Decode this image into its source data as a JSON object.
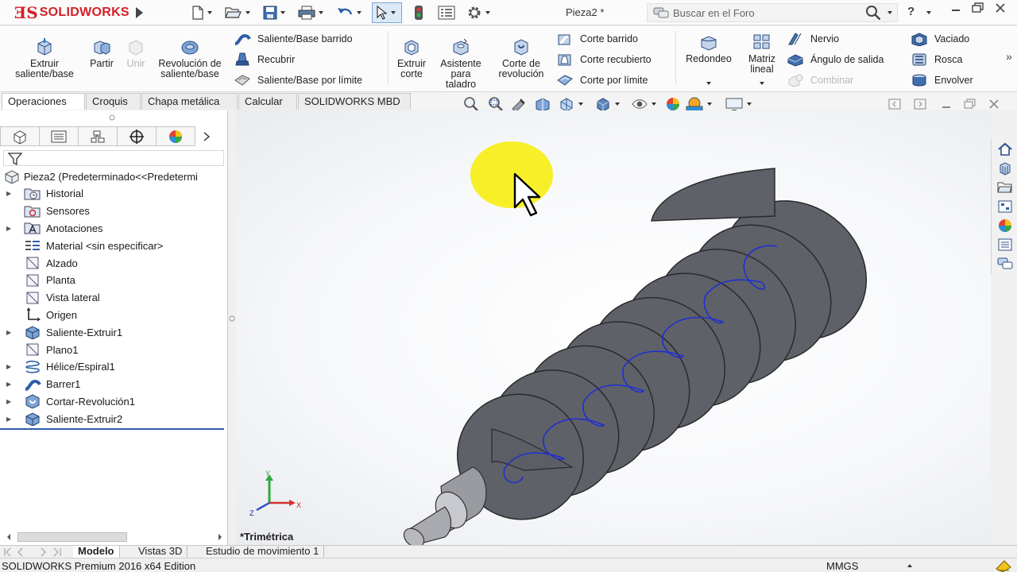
{
  "app": {
    "logo_text": "SOLIDWORKS",
    "document_title": "Pieza2 *",
    "search_placeholder": "Buscar en el Foro",
    "help_glyph": "?"
  },
  "command_manager": {
    "features_big": [
      {
        "label": "Extruir saliente/base",
        "icon": "extrude-boss-icon",
        "enabled": true
      },
      {
        "label": "Partir",
        "icon": "split-icon",
        "enabled": true
      },
      {
        "label": "Unir",
        "icon": "combine-join-icon",
        "enabled": false
      },
      {
        "label": "Revolución de saliente/base",
        "icon": "revolve-boss-icon",
        "enabled": true
      }
    ],
    "features_small": [
      {
        "label": "Saliente/Base barrido",
        "icon": "swept-boss-icon",
        "enabled": true
      },
      {
        "label": "Recubrir",
        "icon": "loft-icon",
        "enabled": true
      },
      {
        "label": "Saliente/Base por límite",
        "icon": "boundary-boss-icon",
        "enabled": true
      }
    ],
    "cut_big": [
      {
        "label": "Extruir corte",
        "icon": "extruded-cut-icon",
        "enabled": true
      },
      {
        "label": "Asistente para taladro",
        "icon": "hole-wizard-icon",
        "enabled": true
      },
      {
        "label": "Corte de revolución",
        "icon": "revolved-cut-icon",
        "enabled": true
      }
    ],
    "cut_small": [
      {
        "label": "Corte barrido",
        "icon": "swept-cut-icon",
        "enabled": true
      },
      {
        "label": "Corte recubierto",
        "icon": "lofted-cut-icon",
        "enabled": true
      },
      {
        "label": "Corte por límite",
        "icon": "boundary-cut-icon",
        "enabled": true
      }
    ],
    "modify_big": [
      {
        "label": "Redondeo",
        "icon": "fillet-icon",
        "enabled": true
      },
      {
        "label": "Matriz lineal",
        "icon": "linear-pattern-icon",
        "enabled": true
      }
    ],
    "modify_small": [
      {
        "label": "Nervio",
        "icon": "rib-icon",
        "enabled": true
      },
      {
        "label": "Ángulo de salida",
        "icon": "draft-icon",
        "enabled": true
      },
      {
        "label": "Combinar",
        "icon": "combine-icon",
        "enabled": false
      }
    ],
    "shell_small": [
      {
        "label": "Vaciado",
        "icon": "shell-icon",
        "enabled": true
      },
      {
        "label": "Rosca",
        "icon": "thread-icon",
        "enabled": true
      },
      {
        "label": "Envolver",
        "icon": "wrap-icon",
        "enabled": true
      }
    ]
  },
  "tabs": [
    {
      "label": "Operaciones",
      "active": true
    },
    {
      "label": "Croquis",
      "active": false
    },
    {
      "label": "Chapa metálica",
      "active": false
    },
    {
      "label": "Calcular",
      "active": false
    },
    {
      "label": "SOLIDWORKS MBD",
      "active": false
    }
  ],
  "feature_tree": {
    "root": "Pieza2  (Predeterminado<<Predetermi",
    "items": [
      {
        "label": "Historial",
        "icon": "history-folder-icon",
        "expandable": true
      },
      {
        "label": "Sensores",
        "icon": "sensors-icon",
        "expandable": false
      },
      {
        "label": "Anotaciones",
        "icon": "annotations-icon",
        "expandable": true
      },
      {
        "label": "Material <sin especificar>",
        "icon": "material-icon",
        "expandable": false
      },
      {
        "label": "Alzado",
        "icon": "plane-icon",
        "expandable": false
      },
      {
        "label": "Planta",
        "icon": "plane-icon",
        "expandable": false
      },
      {
        "label": "Vista lateral",
        "icon": "plane-icon",
        "expandable": false
      },
      {
        "label": "Origen",
        "icon": "origin-icon",
        "expandable": false
      },
      {
        "label": "Saliente-Extruir1",
        "icon": "extrude-feature-icon",
        "expandable": true
      },
      {
        "label": "Plano1",
        "icon": "plane-icon",
        "expandable": false
      },
      {
        "label": "Hélice/Espiral1",
        "icon": "helix-icon",
        "expandable": true
      },
      {
        "label": "Barrer1",
        "icon": "sweep-feature-icon",
        "expandable": true
      },
      {
        "label": "Cortar-Revolución1",
        "icon": "revolve-cut-feature-icon",
        "expandable": true
      },
      {
        "label": "Saliente-Extruir2",
        "icon": "extrude-feature-icon",
        "expandable": true
      }
    ]
  },
  "viewport": {
    "view_name": "*Trimétrica",
    "triad": {
      "x": "X",
      "y": "Y",
      "z": "Z"
    }
  },
  "bottom_tabs": [
    {
      "label": "Modelo",
      "active": true
    },
    {
      "label": "Vistas 3D",
      "active": false
    },
    {
      "label": "Estudio de movimiento 1",
      "active": false
    }
  ],
  "status": {
    "edition": "SOLIDWORKS Premium 2016 x64 Edition",
    "units": "MMGS"
  },
  "colors": {
    "brand_red": "#d32027",
    "model_gray": "#5f6168",
    "helix_blue": "#1f2fd0",
    "cursor_highlight": "#f7ef1c"
  }
}
